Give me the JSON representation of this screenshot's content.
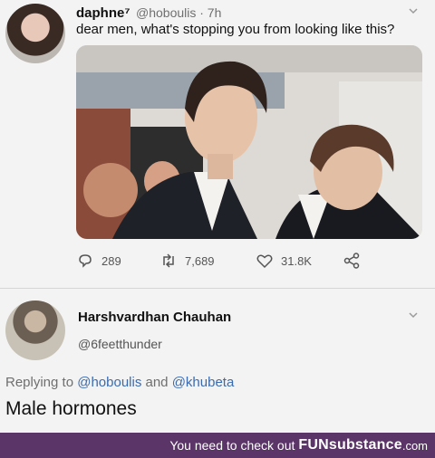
{
  "tweet": {
    "author_name": "daphne⁷",
    "handle_time": "@hoboulis · 7h",
    "text": "dear men, what's stopping you from looking like this?",
    "stats": {
      "replies": "289",
      "retweets": "7,689",
      "likes": "31.8K"
    }
  },
  "reply": {
    "author_name": "Harshvardhan Chauhan",
    "handle": "@6feetthunder",
    "replying_prefix": "Replying to",
    "mention1": "@hoboulis",
    "and_word": "and",
    "mention2": "@khubeta",
    "text": "Male hormones"
  },
  "banner": {
    "prefix": "You need to check out",
    "brand": "FUNsubstance",
    "tld": ".com"
  },
  "colors": {
    "banner_bg": "#5b3468",
    "link": "#3a6bb0"
  },
  "icons": [
    "reply-icon",
    "retweet-icon",
    "like-icon",
    "share-icon",
    "chevron-down-icon"
  ]
}
